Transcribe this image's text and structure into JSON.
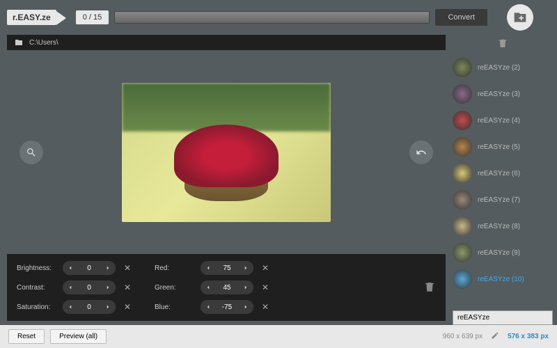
{
  "app": {
    "logo_prefix": "r.",
    "logo_mid": "EASY",
    "logo_suffix": ".ze"
  },
  "topbar": {
    "count": "0 / 15",
    "convert_label": "Convert"
  },
  "path": "C:\\Users\\",
  "controls": {
    "brightness": {
      "label": "Brightness:",
      "value": "0"
    },
    "contrast": {
      "label": "Contrast:",
      "value": "0"
    },
    "saturation": {
      "label": "Saturation:",
      "value": "0"
    },
    "red": {
      "label": "Red:",
      "value": "75"
    },
    "green": {
      "label": "Green:",
      "value": "45"
    },
    "blue": {
      "label": "Blue:",
      "value": "-75"
    }
  },
  "presets": [
    {
      "label": "reEASYze (2)"
    },
    {
      "label": "reEASYze (3)"
    },
    {
      "label": "reEASYze (4)"
    },
    {
      "label": "reEASYze (5)"
    },
    {
      "label": "reEASYze (6)"
    },
    {
      "label": "reEASYze (7)"
    },
    {
      "label": "reEASYze (8)"
    },
    {
      "label": "reEASYze (9)"
    },
    {
      "label": "reEASYze (10)",
      "active": true
    }
  ],
  "preset_input": "reEASYze",
  "bottom": {
    "reset": "Reset",
    "preview_all": "Preview (all)",
    "orig_dims": "960 x 639 px",
    "new_dims": "576 x 383 px"
  }
}
